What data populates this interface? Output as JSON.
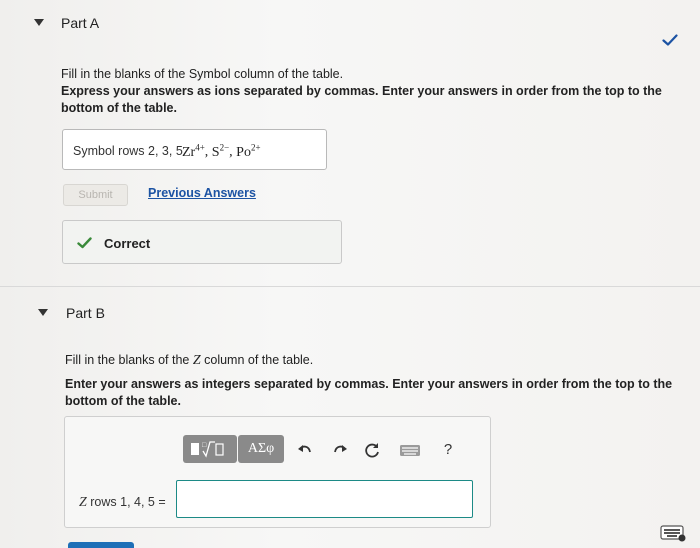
{
  "part_a": {
    "title": "Part A",
    "instruction": "Fill in the blanks of the Symbol column of the table.",
    "bold_instruction": "Express your answers as ions separated by commas. Enter your answers in order from the top to the bottom of the table.",
    "answer_label": "Symbol rows 2, 3, 5",
    "answer_math": {
      "ion1_base": "Zr",
      "ion1_charge": "4+",
      "ion2_base": "S",
      "ion2_charge": "2−",
      "ion3_base": "Po",
      "ion3_charge": "2+",
      "separator": ","
    },
    "submit_label": "Submit",
    "previous_answers_label": "Previous Answers",
    "feedback": "Correct",
    "status_icon": "check-icon",
    "accent_color": "#1c53a3",
    "correct_color": "#3a8a3a"
  },
  "part_b": {
    "title": "Part B",
    "instruction_prefix": "Fill in the blanks of the ",
    "instruction_var": "Z",
    "instruction_suffix": " column of the table.",
    "bold_instruction": "Enter your answers as integers separated by commas. Enter your answers in order from the top to the bottom of the table.",
    "toolbar": {
      "templates_icon": "templates-icon",
      "greek_label": "ΑΣφ",
      "undo_icon": "undo-icon",
      "redo_icon": "redo-icon",
      "reset_icon": "reset-icon",
      "keyboard_icon": "keyboard-icon",
      "help_label": "?"
    },
    "input_label_var": "Z",
    "input_label_rest": " rows 1, 4, 5 =",
    "input_value": "",
    "input_border_color": "#1c8a86"
  }
}
